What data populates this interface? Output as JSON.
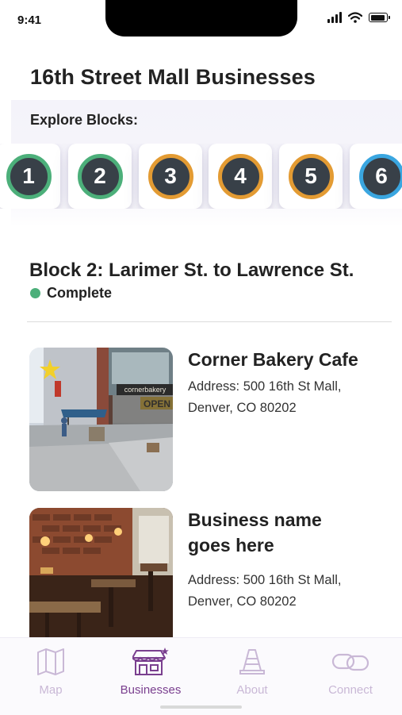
{
  "status_bar": {
    "time": "9:41"
  },
  "page_title": "16th Street Mall Businesses",
  "explore": {
    "label": "Explore Blocks:",
    "blocks": [
      {
        "number": "1",
        "status": "complete",
        "ring_color": "#4caf7a"
      },
      {
        "number": "2",
        "status": "complete",
        "ring_color": "#4caf7a"
      },
      {
        "number": "3",
        "status": "in-progress",
        "ring_color": "#e39b33"
      },
      {
        "number": "4",
        "status": "in-progress",
        "ring_color": "#e39b33"
      },
      {
        "number": "5",
        "status": "in-progress",
        "ring_color": "#e39b33"
      },
      {
        "number": "6",
        "status": "not-started",
        "ring_color": "#3aa6e0"
      }
    ]
  },
  "selected_block": {
    "title": "Block 2: Larimer St. to Lawrence St.",
    "status": "Complete",
    "status_color": "#4caf7a"
  },
  "businesses": [
    {
      "name": "Corner Bakery Cafe",
      "address": "Address: 500 16th St Mall, Denver, CO 80202",
      "starred": true,
      "image": "storefront-photo"
    },
    {
      "name": "Business name goes here",
      "address": "Address: 500 16th St Mall, Denver, CO 80202",
      "starred": false,
      "image": "restaurant-interior-photo"
    }
  ],
  "tab_bar": {
    "active_color": "#7a3f8f",
    "inactive_color": "#c9b8d6",
    "tabs": [
      {
        "label": "Map",
        "icon": "map-icon",
        "active": false
      },
      {
        "label": "Businesses",
        "icon": "storefront-icon",
        "active": true
      },
      {
        "label": "About",
        "icon": "traffic-cone-icon",
        "active": false
      },
      {
        "label": "Connect",
        "icon": "link-icon",
        "active": false
      }
    ]
  }
}
